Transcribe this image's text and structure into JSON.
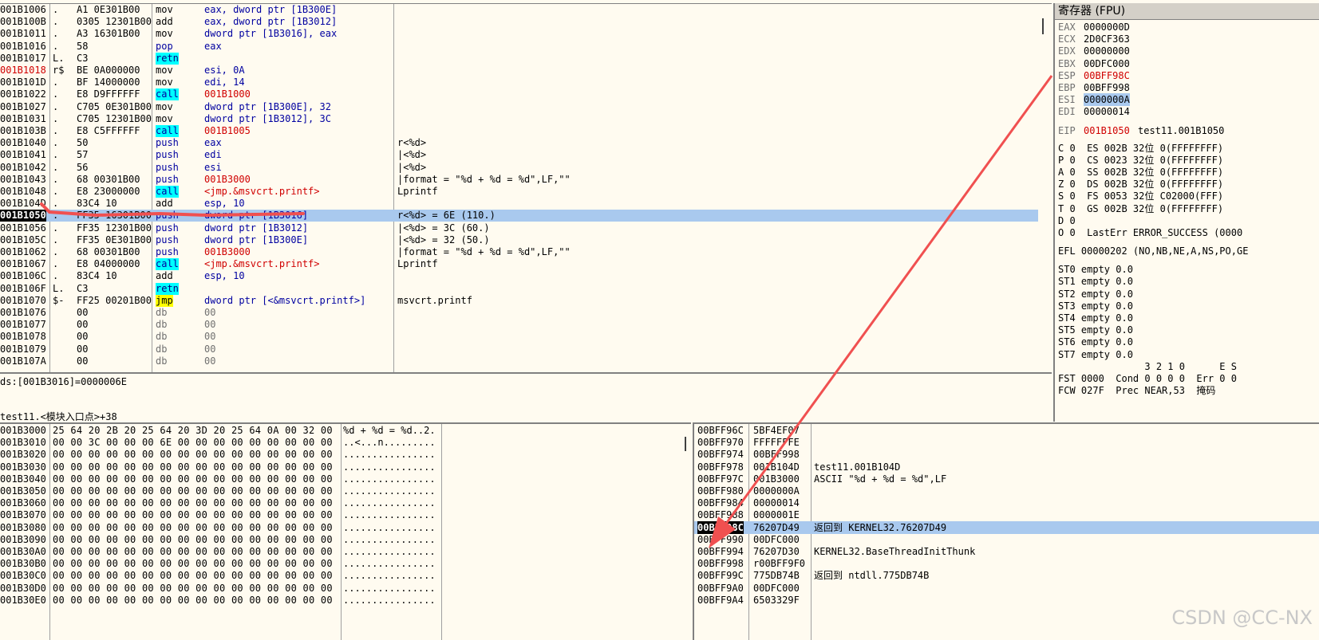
{
  "disasm": {
    "rows": [
      {
        "addr": "001B1006",
        "mark": ".",
        "bytes": "A1 0E301B00",
        "op": "mov",
        "opcls": "",
        "args": "eax, dword ptr [1B300E]",
        "argcls": "",
        "cmt": ""
      },
      {
        "addr": "001B100B",
        "mark": ".",
        "bytes": "0305 12301B00",
        "op": "add",
        "opcls": "",
        "args": "eax, dword ptr [1B3012]",
        "argcls": "",
        "cmt": ""
      },
      {
        "addr": "001B1011",
        "mark": ".",
        "bytes": "A3 16301B00",
        "op": "mov",
        "opcls": "",
        "args": "dword ptr [1B3016], eax",
        "argcls": "",
        "cmt": ""
      },
      {
        "addr": "001B1016",
        "mark": ".",
        "bytes": "58",
        "op": "pop",
        "opcls": "blue",
        "args": "eax",
        "argcls": "",
        "cmt": ""
      },
      {
        "addr": "001B1017",
        "mark": "L.",
        "bytes": "C3",
        "op": "retn",
        "opcls": "retn",
        "args": "",
        "argcls": "",
        "cmt": ""
      },
      {
        "addr": "001B1018",
        "mark": "r$",
        "bytes": "BE 0A000000",
        "op": "mov",
        "opcls": "",
        "args": "esi, 0A",
        "argcls": "",
        "cmt": "",
        "addrcls": "red"
      },
      {
        "addr": "001B101D",
        "mark": ".",
        "bytes": "BF 14000000",
        "op": "mov",
        "opcls": "",
        "args": "edi, 14",
        "argcls": "",
        "cmt": ""
      },
      {
        "addr": "001B1022",
        "mark": ".",
        "bytes": "E8 D9FFFFFF",
        "op": "call",
        "opcls": "call",
        "args": "001B1000",
        "argcls": "red",
        "cmt": ""
      },
      {
        "addr": "001B1027",
        "mark": ".",
        "bytes": "C705 0E301B00",
        "op": "mov",
        "opcls": "",
        "args": "dword ptr [1B300E], 32",
        "argcls": "",
        "cmt": ""
      },
      {
        "addr": "001B1031",
        "mark": ".",
        "bytes": "C705 12301B00",
        "op": "mov",
        "opcls": "",
        "args": "dword ptr [1B3012], 3C",
        "argcls": "",
        "cmt": ""
      },
      {
        "addr": "001B103B",
        "mark": ".",
        "bytes": "E8 C5FFFFFF",
        "op": "call",
        "opcls": "call",
        "args": "001B1005",
        "argcls": "red",
        "cmt": ""
      },
      {
        "addr": "001B1040",
        "mark": ".",
        "bytes": "50",
        "op": "push",
        "opcls": "blue",
        "args": "eax",
        "argcls": "",
        "cmt": "r<%d>"
      },
      {
        "addr": "001B1041",
        "mark": ".",
        "bytes": "57",
        "op": "push",
        "opcls": "blue",
        "args": "edi",
        "argcls": "",
        "cmt": "|<%d>"
      },
      {
        "addr": "001B1042",
        "mark": ".",
        "bytes": "56",
        "op": "push",
        "opcls": "blue",
        "args": "esi",
        "argcls": "",
        "cmt": "|<%d>"
      },
      {
        "addr": "001B1043",
        "mark": ".",
        "bytes": "68 00301B00",
        "op": "push",
        "opcls": "blue",
        "args": "001B3000",
        "argcls": "red",
        "cmt": "|format = \"%d + %d = %d\",LF,\"\""
      },
      {
        "addr": "001B1048",
        "mark": ".",
        "bytes": "E8 23000000",
        "op": "call",
        "opcls": "call",
        "args": "<jmp.&msvcrt.printf>",
        "argcls": "red",
        "cmt": "Lprintf"
      },
      {
        "addr": "001B104D",
        "mark": ".",
        "bytes": "83C4 10",
        "op": "add",
        "opcls": "",
        "args": "esp, 10",
        "argcls": "",
        "cmt": ""
      },
      {
        "addr": "001B1050",
        "mark": ".",
        "bytes": "FF35 16301B00",
        "op": "push",
        "opcls": "blue",
        "args": "dword ptr [1B3016]",
        "argcls": "",
        "cmt": "r<%d> = 6E (110.)",
        "sel": true
      },
      {
        "addr": "001B1056",
        "mark": ".",
        "bytes": "FF35 12301B00",
        "op": "push",
        "opcls": "blue",
        "args": "dword ptr [1B3012]",
        "argcls": "",
        "cmt": "|<%d> = 3C (60.)"
      },
      {
        "addr": "001B105C",
        "mark": ".",
        "bytes": "FF35 0E301B00",
        "op": "push",
        "opcls": "blue",
        "args": "dword ptr [1B300E]",
        "argcls": "",
        "cmt": "|<%d> = 32 (50.)"
      },
      {
        "addr": "001B1062",
        "mark": ".",
        "bytes": "68 00301B00",
        "op": "push",
        "opcls": "blue",
        "args": "001B3000",
        "argcls": "red",
        "cmt": "|format = \"%d + %d = %d\",LF,\"\""
      },
      {
        "addr": "001B1067",
        "mark": ".",
        "bytes": "E8 04000000",
        "op": "call",
        "opcls": "call",
        "args": "<jmp.&msvcrt.printf>",
        "argcls": "red",
        "cmt": "Lprintf"
      },
      {
        "addr": "001B106C",
        "mark": ".",
        "bytes": "83C4 10",
        "op": "add",
        "opcls": "",
        "args": "esp, 10",
        "argcls": "",
        "cmt": ""
      },
      {
        "addr": "001B106F",
        "mark": "L.",
        "bytes": "C3",
        "op": "retn",
        "opcls": "retn",
        "args": "",
        "argcls": "",
        "cmt": ""
      },
      {
        "addr": "001B1070",
        "mark": "$-",
        "bytes": "FF25 00201B00",
        "op": "jmp",
        "opcls": "jmp",
        "args": "dword ptr [<&msvcrt.printf>]",
        "argcls": "",
        "cmt": "msvcrt.printf"
      },
      {
        "addr": "001B1076",
        "mark": "",
        "bytes": "00",
        "op": "db",
        "opcls": "gray",
        "args": "00",
        "argcls": "gray",
        "cmt": ""
      },
      {
        "addr": "001B1077",
        "mark": "",
        "bytes": "00",
        "op": "db",
        "opcls": "gray",
        "args": "00",
        "argcls": "gray",
        "cmt": ""
      },
      {
        "addr": "001B1078",
        "mark": "",
        "bytes": "00",
        "op": "db",
        "opcls": "gray",
        "args": "00",
        "argcls": "gray",
        "cmt": ""
      },
      {
        "addr": "001B1079",
        "mark": "",
        "bytes": "00",
        "op": "db",
        "opcls": "gray",
        "args": "00",
        "argcls": "gray",
        "cmt": ""
      },
      {
        "addr": "001B107A",
        "mark": "",
        "bytes": "00",
        "op": "db",
        "opcls": "gray",
        "args": "00",
        "argcls": "gray",
        "cmt": ""
      }
    ]
  },
  "info": {
    "line1": "ds:[001B3016]=0000006E",
    "line2": "test11.<模块入口点>+38"
  },
  "registers": {
    "title": "寄存器 (FPU)",
    "gp": [
      {
        "name": "EAX",
        "val": "0000000D",
        "cls": ""
      },
      {
        "name": "ECX",
        "val": "2D0CF363",
        "cls": ""
      },
      {
        "name": "EDX",
        "val": "00000000",
        "cls": ""
      },
      {
        "name": "EBX",
        "val": "00DFC000",
        "cls": ""
      },
      {
        "name": "ESP",
        "val": "00BFF98C",
        "cls": "red"
      },
      {
        "name": "EBP",
        "val": "00BFF998",
        "cls": ""
      },
      {
        "name": "ESI",
        "val": "0000000A",
        "cls": "hl"
      },
      {
        "name": "EDI",
        "val": "00000014",
        "cls": ""
      }
    ],
    "eip": {
      "name": "EIP",
      "val": "001B1050",
      "desc": "test11.001B1050"
    },
    "flags": [
      "C 0  ES 002B 32位 0(FFFFFFFF)",
      "P 0  CS 0023 32位 0(FFFFFFFF)",
      "A 0  SS 002B 32位 0(FFFFFFFF)",
      "Z 0  DS 002B 32位 0(FFFFFFFF)",
      "S 0  FS 0053 32位 C02000(FFF)",
      "T 0  GS 002B 32位 0(FFFFFFFF)",
      "D 0",
      "O 0  LastErr ERROR_SUCCESS (0000"
    ],
    "efl": "EFL 00000202 (NO,NB,NE,A,NS,PO,GE",
    "st": [
      "ST0 empty 0.0",
      "ST1 empty 0.0",
      "ST2 empty 0.0",
      "ST3 empty 0.0",
      "ST4 empty 0.0",
      "ST5 empty 0.0",
      "ST6 empty 0.0",
      "ST7 empty 0.0"
    ],
    "fpu_hdr": "               3 2 1 0      E S",
    "fst": "FST 0000  Cond 0 0 0 0  Err 0 0",
    "fcw": "FCW 027F  Prec NEAR,53  掩码"
  },
  "dump": {
    "rows": [
      {
        "addr": "001B3000",
        "hex": "25 64 20 2B 20 25 64 20 3D 20 25 64 0A 00 32 00",
        "ascii": "%d + %d = %d..2."
      },
      {
        "addr": "001B3010",
        "hex": "00 00 3C 00 00 00 6E 00 00 00 00 00 00 00 00 00",
        "ascii": "..<...n........."
      },
      {
        "addr": "001B3020",
        "hex": "00 00 00 00 00 00 00 00 00 00 00 00 00 00 00 00",
        "ascii": "................"
      },
      {
        "addr": "001B3030",
        "hex": "00 00 00 00 00 00 00 00 00 00 00 00 00 00 00 00",
        "ascii": "................"
      },
      {
        "addr": "001B3040",
        "hex": "00 00 00 00 00 00 00 00 00 00 00 00 00 00 00 00",
        "ascii": "................"
      },
      {
        "addr": "001B3050",
        "hex": "00 00 00 00 00 00 00 00 00 00 00 00 00 00 00 00",
        "ascii": "................"
      },
      {
        "addr": "001B3060",
        "hex": "00 00 00 00 00 00 00 00 00 00 00 00 00 00 00 00",
        "ascii": "................"
      },
      {
        "addr": "001B3070",
        "hex": "00 00 00 00 00 00 00 00 00 00 00 00 00 00 00 00",
        "ascii": "................"
      },
      {
        "addr": "001B3080",
        "hex": "00 00 00 00 00 00 00 00 00 00 00 00 00 00 00 00",
        "ascii": "................"
      },
      {
        "addr": "001B3090",
        "hex": "00 00 00 00 00 00 00 00 00 00 00 00 00 00 00 00",
        "ascii": "................"
      },
      {
        "addr": "001B30A0",
        "hex": "00 00 00 00 00 00 00 00 00 00 00 00 00 00 00 00",
        "ascii": "................"
      },
      {
        "addr": "001B30B0",
        "hex": "00 00 00 00 00 00 00 00 00 00 00 00 00 00 00 00",
        "ascii": "................"
      },
      {
        "addr": "001B30C0",
        "hex": "00 00 00 00 00 00 00 00 00 00 00 00 00 00 00 00",
        "ascii": "................"
      },
      {
        "addr": "001B30D0",
        "hex": "00 00 00 00 00 00 00 00 00 00 00 00 00 00 00 00",
        "ascii": "................"
      },
      {
        "addr": "001B30E0",
        "hex": "00 00 00 00 00 00 00 00 00 00 00 00 00 00 00 00",
        "ascii": "................"
      }
    ]
  },
  "stack": {
    "rows": [
      {
        "addr": "00BFF96C",
        "val": "5BF4EF07",
        "cmt": ""
      },
      {
        "addr": "00BFF970",
        "val": "FFFFFFFE",
        "cmt": ""
      },
      {
        "addr": "00BFF974",
        "val": "00BFF998",
        "cmt": ""
      },
      {
        "addr": "00BFF978",
        "val": "001B104D",
        "cmt": "test11.001B104D"
      },
      {
        "addr": "00BFF97C",
        "val": "001B3000",
        "cmt": "ASCII \"%d + %d = %d\",LF"
      },
      {
        "addr": "00BFF980",
        "val": "0000000A",
        "cmt": ""
      },
      {
        "addr": "00BFF984",
        "val": "00000014",
        "cmt": ""
      },
      {
        "addr": "00BFF988",
        "val": "0000001E",
        "cmt": ""
      },
      {
        "addr": "00BFF98C",
        "val": "76207D49",
        "cmt": "返回到 KERNEL32.76207D49",
        "sel": true
      },
      {
        "addr": "00BFF990",
        "val": "00DFC000",
        "cmt": ""
      },
      {
        "addr": "00BFF994",
        "val": "76207D30",
        "cmt": "KERNEL32.BaseThreadInitThunk"
      },
      {
        "addr": "00BFF998",
        "val": "r00BFF9F0",
        "cmt": ""
      },
      {
        "addr": "00BFF99C",
        "val": "775DB74B",
        "cmt": "返回到 ntdll.775DB74B"
      },
      {
        "addr": "00BFF9A0",
        "val": "00DFC000",
        "cmt": ""
      },
      {
        "addr": "00BFF9A4",
        "val": "6503329F",
        "cmt": ""
      }
    ]
  },
  "watermark": "CSDN @CC-NX",
  "colors": {
    "bg": "#fffbf0",
    "selection": "#a9c9ee",
    "annotation": "#f05050"
  }
}
